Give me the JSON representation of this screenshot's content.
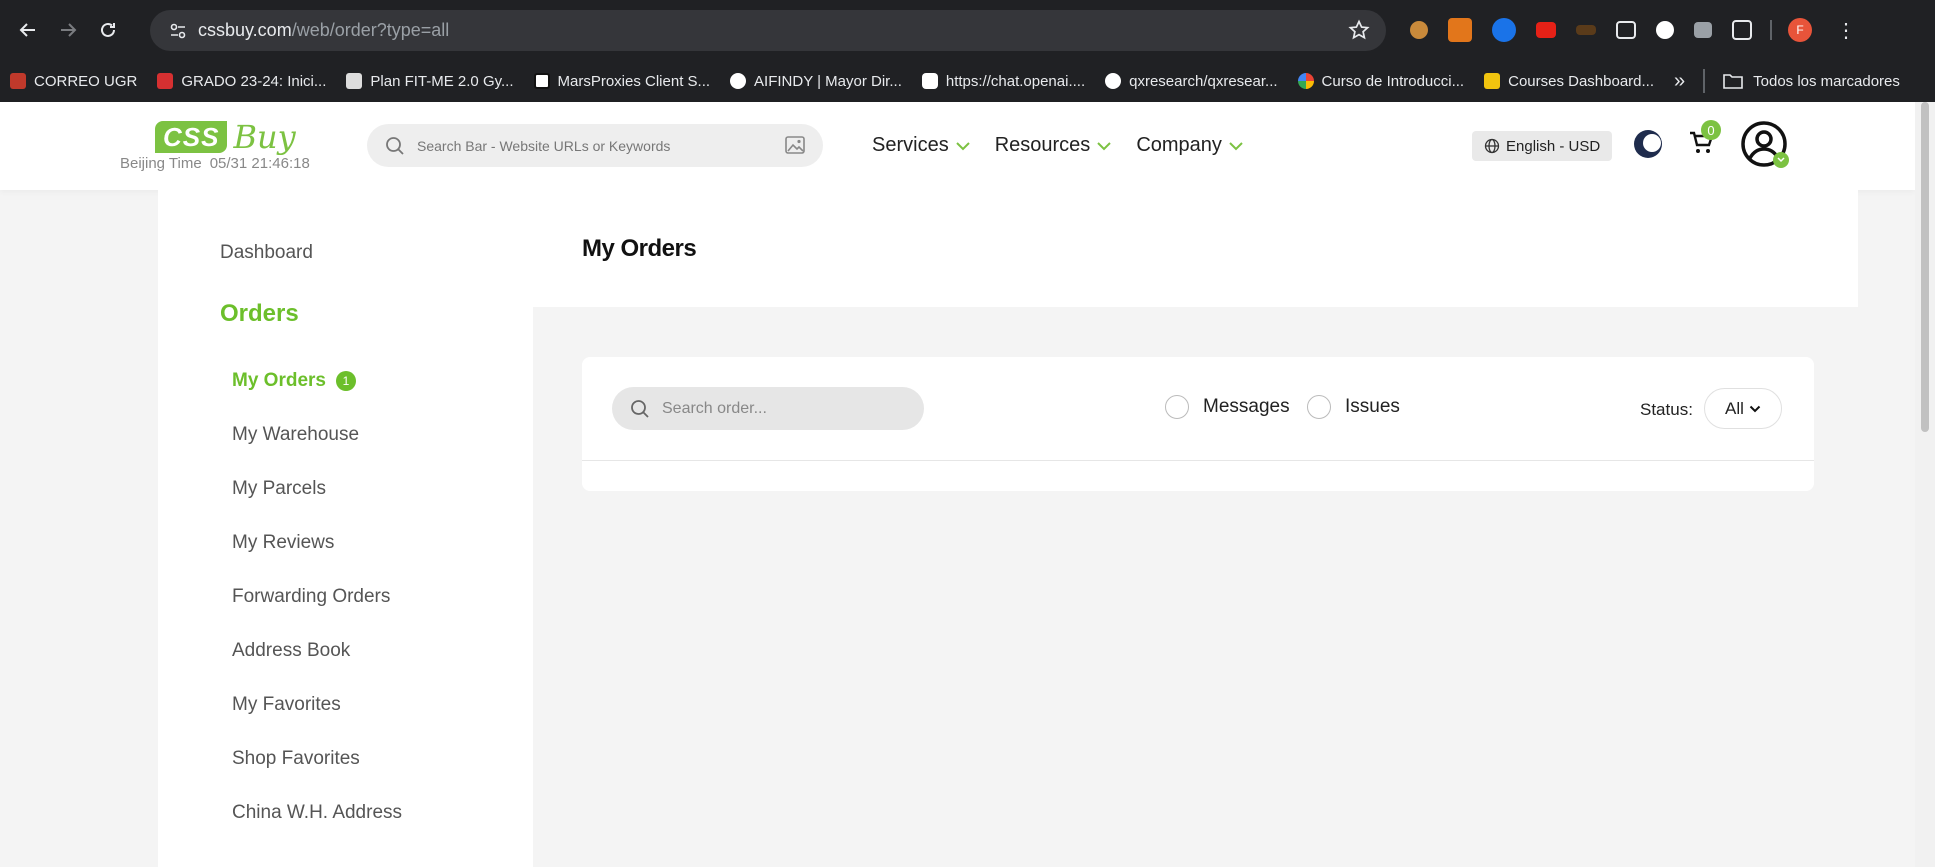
{
  "browser": {
    "url_host": "cssbuy.com",
    "url_path": "/web/order?type=all",
    "bookmarks": [
      {
        "label": "CORREO UGR",
        "color": "#c0392b"
      },
      {
        "label": "GRADO 23-24: Inici...",
        "color": "#d63031"
      },
      {
        "label": "Plan FIT-ME 2.0 Gy...",
        "color": "#dddddd"
      },
      {
        "label": "MarsProxies Client S...",
        "color": "#111111"
      },
      {
        "label": "AIFINDY | Mayor Dir...",
        "color": "#ffffff"
      },
      {
        "label": "https://chat.openai....",
        "color": "#ffffff"
      },
      {
        "label": "qxresearch/qxresear...",
        "color": "#ffffff"
      },
      {
        "label": "Curso de Introducci...",
        "color": "#4285f4"
      },
      {
        "label": "Courses Dashboard...",
        "color": "#f1c40f"
      }
    ],
    "bookmarks_overflow": "»",
    "all_bookmarks": "Todos los marcadores",
    "profile_initial": "F"
  },
  "site": {
    "logo_css": "CSS",
    "logo_buy": "Buy",
    "beijing_label": "Beijing Time",
    "beijing_time": "05/31 21:46:18",
    "search_placeholder": "Search Bar - Website URLs or Keywords",
    "nav": [
      "Services",
      "Resources",
      "Company"
    ],
    "language": "English - USD",
    "cart_count": "0",
    "accent_color": "#7cc242"
  },
  "sidebar": {
    "dashboard": "Dashboard",
    "orders_title": "Orders",
    "items": [
      {
        "label": "My Orders",
        "badge": "1",
        "active": true
      },
      {
        "label": "My Warehouse"
      },
      {
        "label": "My Parcels"
      },
      {
        "label": "My Reviews"
      },
      {
        "label": "Forwarding Orders"
      },
      {
        "label": "Address Book"
      },
      {
        "label": "My Favorites"
      },
      {
        "label": "Shop Favorites"
      },
      {
        "label": "China W.H. Address"
      }
    ]
  },
  "main": {
    "title": "My Orders",
    "search_placeholder": "Search order...",
    "filter_messages": "Messages",
    "filter_issues": "Issues",
    "status_label": "Status:",
    "status_value": "All"
  }
}
